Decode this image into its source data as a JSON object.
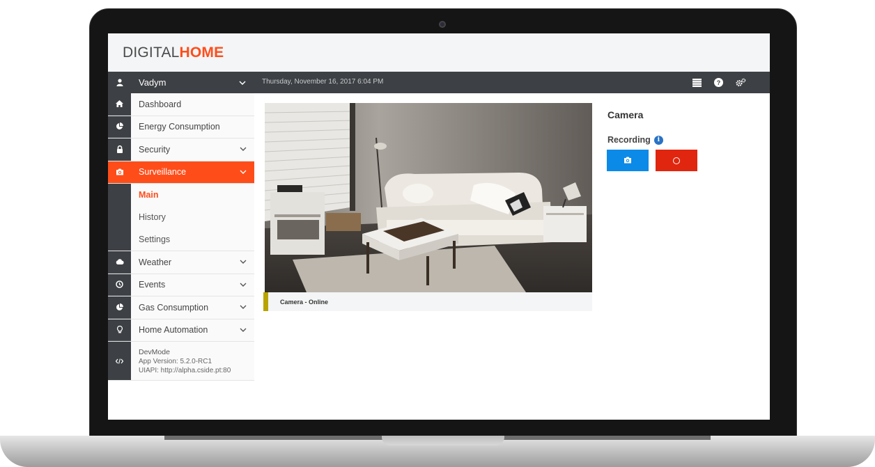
{
  "app": {
    "logo_part1": "DIGITAL",
    "logo_part2": "HOME",
    "accent_color": "#ff4d1a"
  },
  "topbar": {
    "user_name": "Vadym",
    "datetime": "Thursday, November 16, 2017 6:04 PM",
    "icons": [
      "list-icon",
      "help-icon",
      "settings-icon"
    ]
  },
  "sidebar": {
    "items": [
      {
        "label": "Dashboard",
        "icon": "home-icon"
      },
      {
        "label": "Energy Consumption",
        "icon": "pie-chart-icon"
      },
      {
        "label": "Security",
        "icon": "lock-icon"
      },
      {
        "label": "Surveillance",
        "icon": "camera-icon"
      },
      {
        "label": "Weather",
        "icon": "cloud-icon"
      },
      {
        "label": "Events",
        "icon": "clock-icon"
      },
      {
        "label": "Gas Consumption",
        "icon": "pie-chart-icon"
      },
      {
        "label": "Home Automation",
        "icon": "lightbulb-icon"
      }
    ],
    "surveillance_sub": [
      "Main",
      "History",
      "Settings"
    ],
    "devmode": {
      "title": "DevMode",
      "app_version": "App Version: 5.2.0-RC1",
      "uiapi": "UIAPI: http://alpha.cside.pt:80"
    }
  },
  "main": {
    "camera_status": "Camera - Online",
    "camera_heading": "Camera",
    "recording_label": "Recording"
  }
}
